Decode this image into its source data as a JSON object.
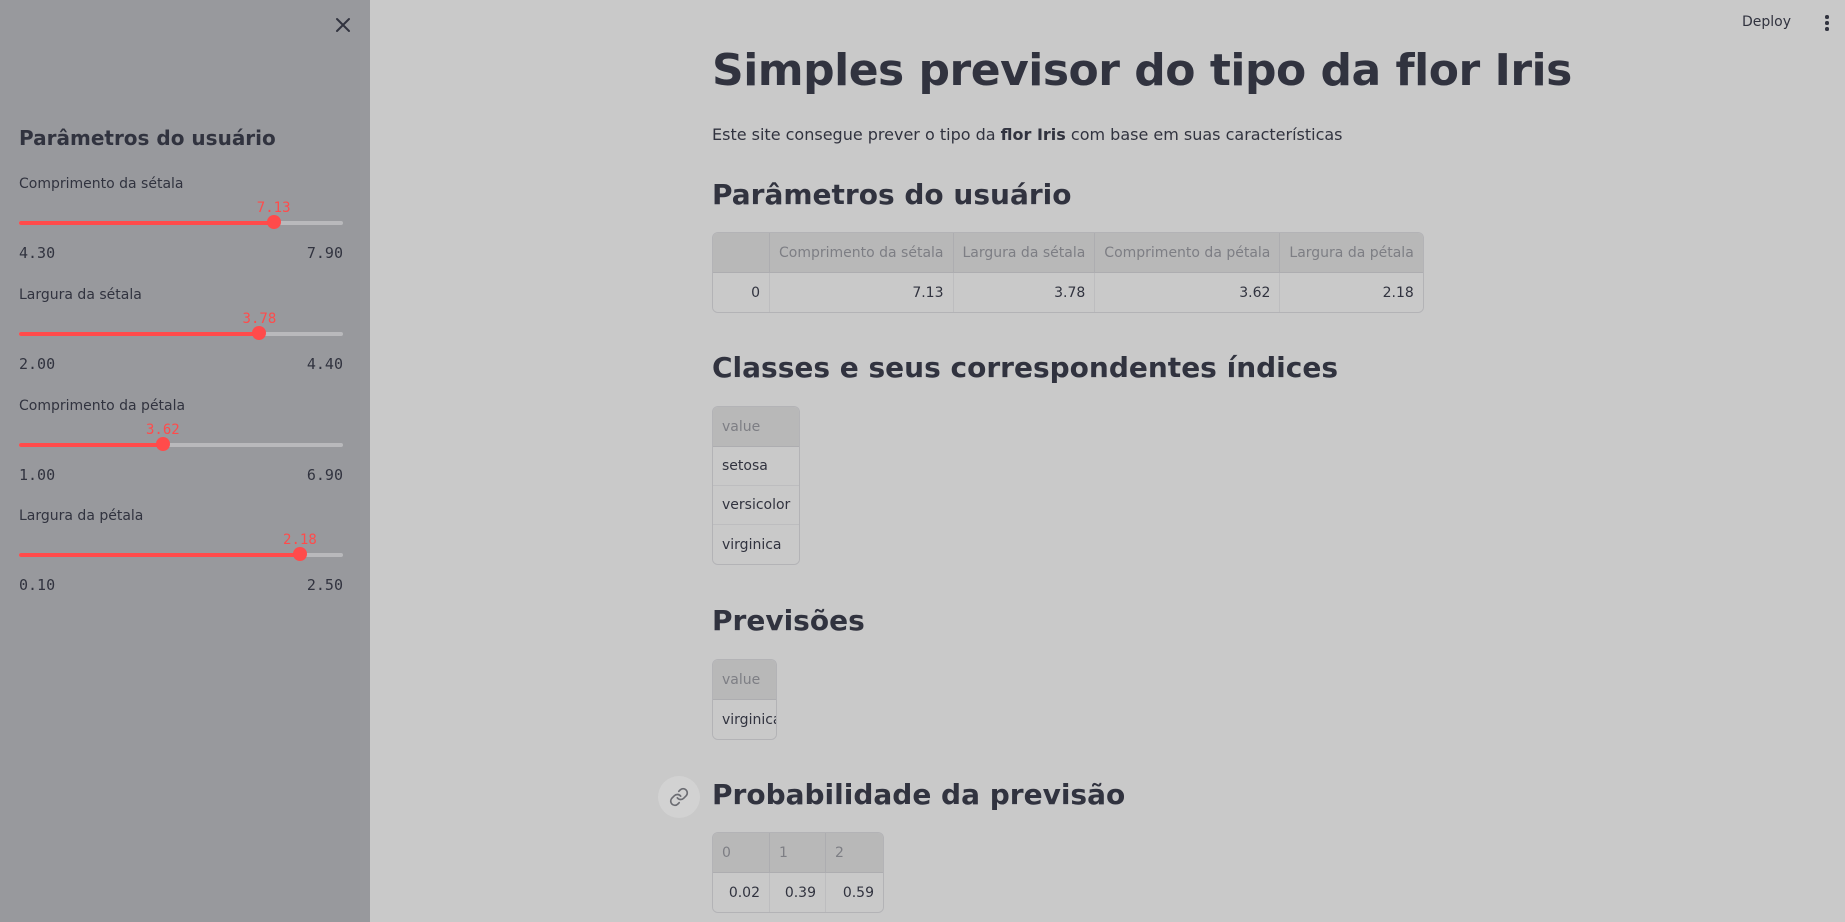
{
  "sidebar": {
    "title": "Parâmetros do usuário",
    "sliders": [
      {
        "label": "Comprimento da sétala",
        "value": "7.13",
        "min": "4.30",
        "max": "7.90",
        "fraction": 0.786
      },
      {
        "label": "Largura da sétala",
        "value": "3.78",
        "min": "2.00",
        "max": "4.40",
        "fraction": 0.742
      },
      {
        "label": "Comprimento da pétala",
        "value": "3.62",
        "min": "1.00",
        "max": "6.90",
        "fraction": 0.444
      },
      {
        "label": "Largura da pétala",
        "value": "2.18",
        "min": "0.10",
        "max": "2.50",
        "fraction": 0.867
      }
    ]
  },
  "header": {
    "deploy_label": "Deploy"
  },
  "main": {
    "title": "Simples previsor do tipo da flor Iris",
    "intro": {
      "before": "Este site consegue prever o tipo da ",
      "bold": "flor Iris",
      "after": " com base em suas características"
    },
    "params_heading": "Parâmetros do usuário",
    "params_table": {
      "columns": [
        "",
        "Comprimento da sétala",
        "Largura da sétala",
        "Comprimento da pétala",
        "Largura da pétala"
      ],
      "rows": [
        [
          "0",
          "7.13",
          "3.78",
          "3.62",
          "2.18"
        ]
      ]
    },
    "classes_heading": "Classes e seus correspondentes índices",
    "classes_table": {
      "columns": [
        "value"
      ],
      "rows": [
        [
          "setosa"
        ],
        [
          "versicolor"
        ],
        [
          "virginica"
        ]
      ]
    },
    "predictions_heading": "Previsões",
    "predictions_table": {
      "columns": [
        "value"
      ],
      "rows": [
        [
          "virginica"
        ]
      ]
    },
    "probability_heading": "Probabilidade da previsão",
    "probability_table": {
      "columns": [
        "0",
        "1",
        "2"
      ],
      "rows": [
        [
          "0.02",
          "0.39",
          "0.59"
        ]
      ]
    }
  },
  "colors": {
    "accent": "#ff4b4b",
    "sidebar_bg": "#98999d",
    "main_bg": "#c9c9c9",
    "text": "#31333f"
  },
  "icons": {
    "close": "close-icon",
    "menu": "kebab-menu-icon",
    "anchor": "link-icon"
  }
}
